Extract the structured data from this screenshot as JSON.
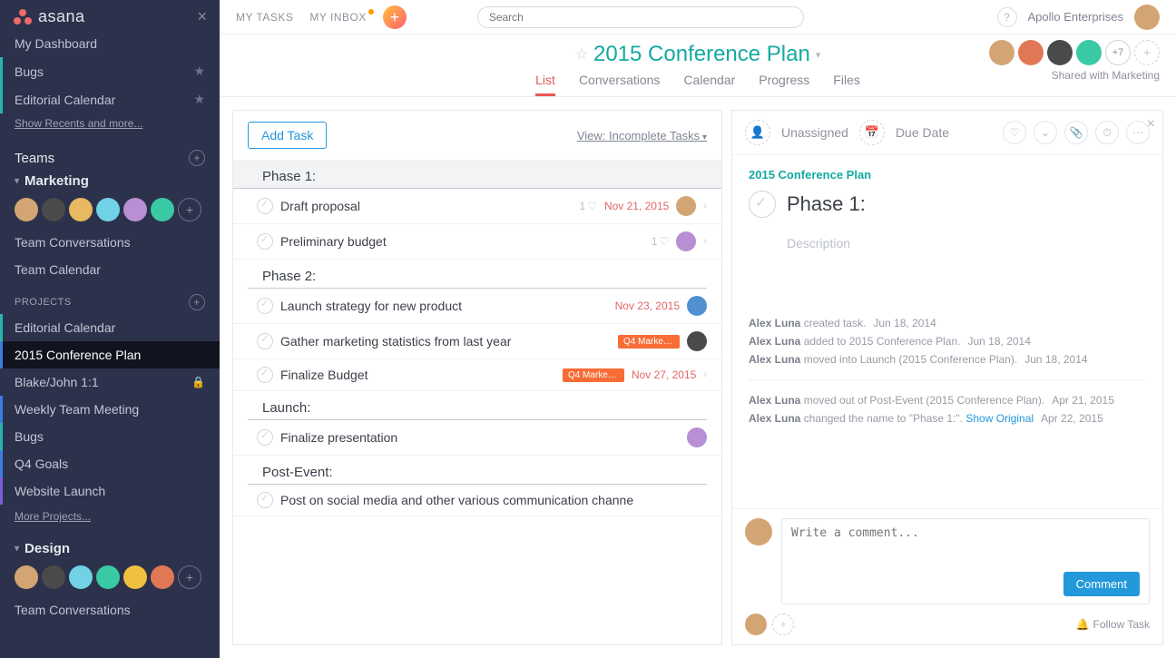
{
  "brand": "asana",
  "sidebar": {
    "dashboard": "My Dashboard",
    "bugs_fav": "Bugs",
    "editorial_fav": "Editorial Calendar",
    "show_recents": "Show Recents and more...",
    "teams_label": "Teams",
    "marketing": {
      "name": "Marketing",
      "team_convos": "Team Conversations",
      "team_cal": "Team Calendar",
      "projects_label": "PROJECTS",
      "projects": [
        "Editorial Calendar",
        "2015 Conference Plan",
        "Blake/John 1:1",
        "Weekly Team Meeting",
        "Bugs",
        "Q4 Goals",
        "Website Launch"
      ],
      "more_projects": "More Projects..."
    },
    "design": {
      "name": "Design",
      "team_convos": "Team Conversations"
    }
  },
  "topbar": {
    "my_tasks": "MY TASKS",
    "my_inbox": "MY INBOX",
    "search_placeholder": "Search",
    "org": "Apollo Enterprises"
  },
  "project": {
    "title": "2015 Conference Plan",
    "tabs": [
      "List",
      "Conversations",
      "Calendar",
      "Progress",
      "Files"
    ],
    "members_plus": "+7",
    "shared_with": "Shared with Marketing"
  },
  "tasklist": {
    "add_task": "Add Task",
    "view_label": "View: Incomplete Tasks",
    "sections": [
      {
        "name": "Phase 1:",
        "tasks": [
          {
            "name": "Draft proposal",
            "likes": "1",
            "due": "Nov 21, 2015"
          },
          {
            "name": "Preliminary budget",
            "likes": "1"
          }
        ]
      },
      {
        "name": "Phase 2:",
        "tasks": [
          {
            "name": "Launch strategy for new product",
            "due": "Nov 23, 2015"
          },
          {
            "name": "Gather marketing statistics from last year",
            "tag": "Q4 Marketi..."
          },
          {
            "name": "Finalize Budget",
            "tag": "Q4 Marketi...",
            "due": "Nov 27, 2015"
          }
        ]
      },
      {
        "name": "Launch:",
        "tasks": [
          {
            "name": "Finalize presentation"
          }
        ]
      },
      {
        "name": "Post-Event:",
        "tasks": [
          {
            "name": "Post on social media and other various communication channe"
          }
        ]
      }
    ]
  },
  "detail": {
    "unassigned": "Unassigned",
    "due_date": "Due Date",
    "project_link": "2015 Conference Plan",
    "title": "Phase 1:",
    "description": "Description",
    "activity": [
      {
        "who": "Alex Luna",
        "what": " created task.",
        "date": "Jun 18, 2014"
      },
      {
        "who": "Alex Luna",
        "what": " added to 2015 Conference Plan.",
        "date": "Jun 18, 2014"
      },
      {
        "who": "Alex Luna",
        "what": " moved into Launch (2015 Conference Plan).",
        "date": "Jun 18, 2014"
      }
    ],
    "activity2": [
      {
        "who": "Alex Luna",
        "what": " moved out of Post-Event (2015 Conference Plan).",
        "date": "Apr 21, 2015"
      },
      {
        "who": "Alex Luna",
        "what": " changed the name to \"Phase 1:\".",
        "date": "Apr 22, 2015",
        "show_original": "Show Original"
      }
    ],
    "comment_placeholder": "Write a comment...",
    "comment_btn": "Comment",
    "follow": "Follow Task"
  }
}
